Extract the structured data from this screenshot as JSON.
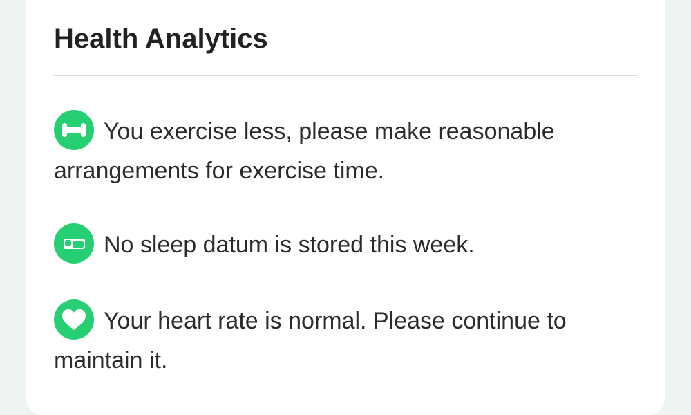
{
  "card": {
    "title": "Health Analytics"
  },
  "insights": [
    {
      "icon": "dumbbell-icon",
      "text": "You exercise less, please make reasonable arrangements for exercise time."
    },
    {
      "icon": "bed-icon",
      "text": "No sleep datum is stored this week."
    },
    {
      "icon": "heart-icon",
      "text": "Your heart rate is normal. Please continue to maintain it."
    }
  ],
  "colors": {
    "accent": "#27cf73",
    "background": "#eef3f3",
    "card": "#ffffff",
    "divider": "#dcdcdc",
    "text": "#2b2b2b"
  }
}
